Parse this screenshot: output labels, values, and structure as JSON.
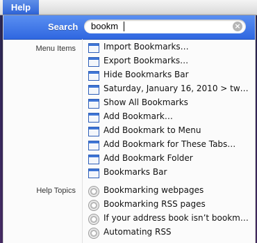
{
  "menubar": {
    "menu": "Help"
  },
  "search": {
    "label": "Search",
    "value": "bookm",
    "clear_symbol": "×"
  },
  "sections": {
    "menu_items_label": "Menu Items",
    "help_topics_label": "Help Topics"
  },
  "menu_items": [
    "Import Bookmarks…",
    "Export Bookmarks…",
    "Hide Bookmarks Bar",
    "Saturday, January 16, 2010 > tw…",
    "Show All Bookmarks",
    "Add Bookmark…",
    "Add Bookmark to Menu",
    "Add Bookmark for These Tabs…",
    "Add Bookmark Folder",
    "Bookmarks Bar"
  ],
  "help_topics": [
    "Bookmarking webpages",
    "Bookmarking RSS pages",
    "If your address book isn’t bookm…",
    "Automating RSS"
  ],
  "icons": {
    "menu_item": "window-menu-icon",
    "help_topic": "help-topic-icon"
  },
  "colors": {
    "highlight": "#2f67e0",
    "menubar": "#e4e4e4"
  }
}
